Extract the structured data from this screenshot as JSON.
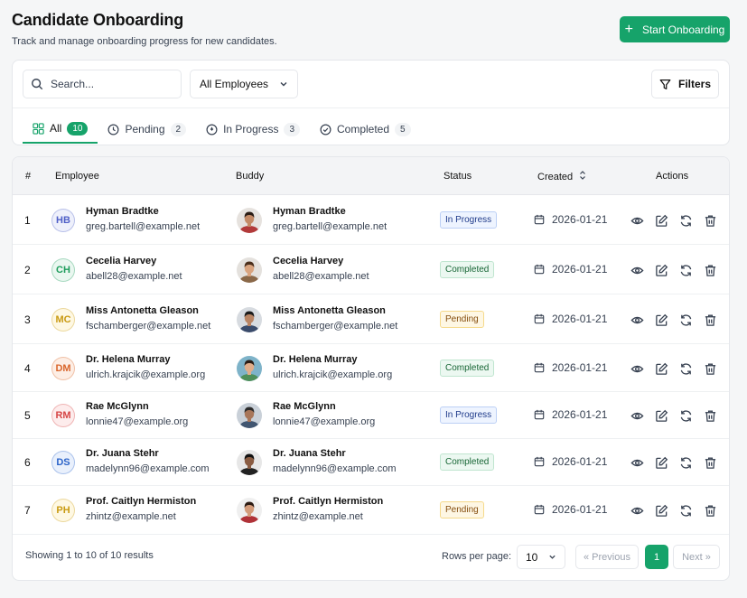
{
  "header": {
    "title": "Candidate Onboarding",
    "subtitle": "Track and manage onboarding progress for new candidates.",
    "start_button": "Start Onboarding"
  },
  "filters": {
    "search_placeholder": "Search...",
    "employee_select": "All Employees",
    "filters_button": "Filters"
  },
  "tabs": [
    {
      "label": "All",
      "count": "10",
      "icon": "grid-icon"
    },
    {
      "label": "Pending",
      "count": "2",
      "icon": "clock-icon"
    },
    {
      "label": "In Progress",
      "count": "3",
      "icon": "loading-icon"
    },
    {
      "label": "Completed",
      "count": "5",
      "icon": "check-circle-icon"
    }
  ],
  "table": {
    "headers": {
      "num": "#",
      "employee": "Employee",
      "buddy": "Buddy",
      "status": "Status",
      "created": "Created",
      "actions": "Actions"
    },
    "rows": [
      {
        "num": "1",
        "initials": "HB",
        "name": "Hyman Bradtke",
        "email": "greg.bartell@example.net",
        "buddy_name": "Hyman Bradtke",
        "buddy_email": "greg.bartell@example.net",
        "status": "In Progress",
        "created": "2026-01-21"
      },
      {
        "num": "2",
        "initials": "CH",
        "name": "Cecelia Harvey",
        "email": "abell28@example.net",
        "buddy_name": "Cecelia Harvey",
        "buddy_email": "abell28@example.net",
        "status": "Completed",
        "created": "2026-01-21"
      },
      {
        "num": "3",
        "initials": "MC",
        "name": "Miss Antonetta Gleason",
        "email": "fschamberger@example.net",
        "buddy_name": "Miss Antonetta Gleason",
        "buddy_email": "fschamberger@example.net",
        "status": "Pending",
        "created": "2026-01-21"
      },
      {
        "num": "4",
        "initials": "DM",
        "name": "Dr. Helena Murray",
        "email": "ulrich.krajcik@example.org",
        "buddy_name": "Dr. Helena Murray",
        "buddy_email": "ulrich.krajcik@example.org",
        "status": "Completed",
        "created": "2026-01-21"
      },
      {
        "num": "5",
        "initials": "RM",
        "name": "Rae McGlynn",
        "email": "lonnie47@example.org",
        "buddy_name": "Rae McGlynn",
        "buddy_email": "lonnie47@example.org",
        "status": "In Progress",
        "created": "2026-01-21"
      },
      {
        "num": "6",
        "initials": "DS",
        "name": "Dr. Juana Stehr",
        "email": "madelynn96@example.com",
        "buddy_name": "Dr. Juana Stehr",
        "buddy_email": "madelynn96@example.com",
        "status": "Completed",
        "created": "2026-01-21"
      },
      {
        "num": "7",
        "initials": "PH",
        "name": "Prof. Caitlyn Hermiston",
        "email": "zhintz@example.net",
        "buddy_name": "Prof. Caitlyn Hermiston",
        "buddy_email": "zhintz@example.net",
        "status": "Pending",
        "created": "2026-01-21"
      }
    ]
  },
  "footer": {
    "showing": "Showing 1 to 10 of 10 results",
    "rows_per_page_label": "Rows per page:",
    "rows_per_page_value": "10",
    "previous": "« Previous",
    "current_page": "1",
    "next": "Next »"
  },
  "colors": {
    "accent": "#16a36a",
    "initials": [
      "#4f5fc7",
      "#1f9d5c",
      "#c99a12",
      "#d9652b",
      "#d64545",
      "#2b63c9",
      "#c99a12"
    ]
  }
}
